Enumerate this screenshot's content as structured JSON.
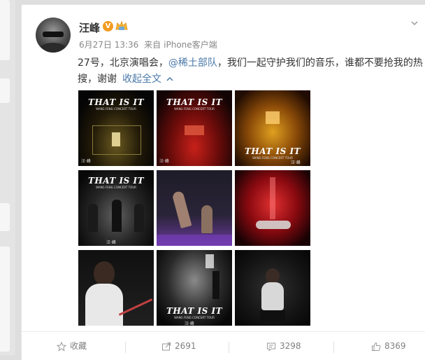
{
  "post": {
    "author": "汪峰",
    "verified_badge": "V",
    "date": "6月27日 13:36",
    "source_prefix": "来自",
    "source": "iPhone客户端",
    "text_part1": "27号，北京演唱会，",
    "mention": "@稀土部队",
    "text_part2": "，我们一起守护我们的音乐，谁都不要抢我的热搜，谢谢",
    "collapse_label": "收起全文",
    "collapse_icon": "chevron-up-icon"
  },
  "photos": {
    "logo": "THAT IS IT",
    "subtitle": "WANG FENG CONCERT TOUR",
    "watermark": "汪·峰"
  },
  "actions": {
    "favorite_label": "收藏",
    "repost_count": "2691",
    "comment_count": "3298",
    "like_count": "8369"
  },
  "colors": {
    "link": "#4a78a8",
    "verified": "#f29b1f",
    "meta": "#888888"
  }
}
